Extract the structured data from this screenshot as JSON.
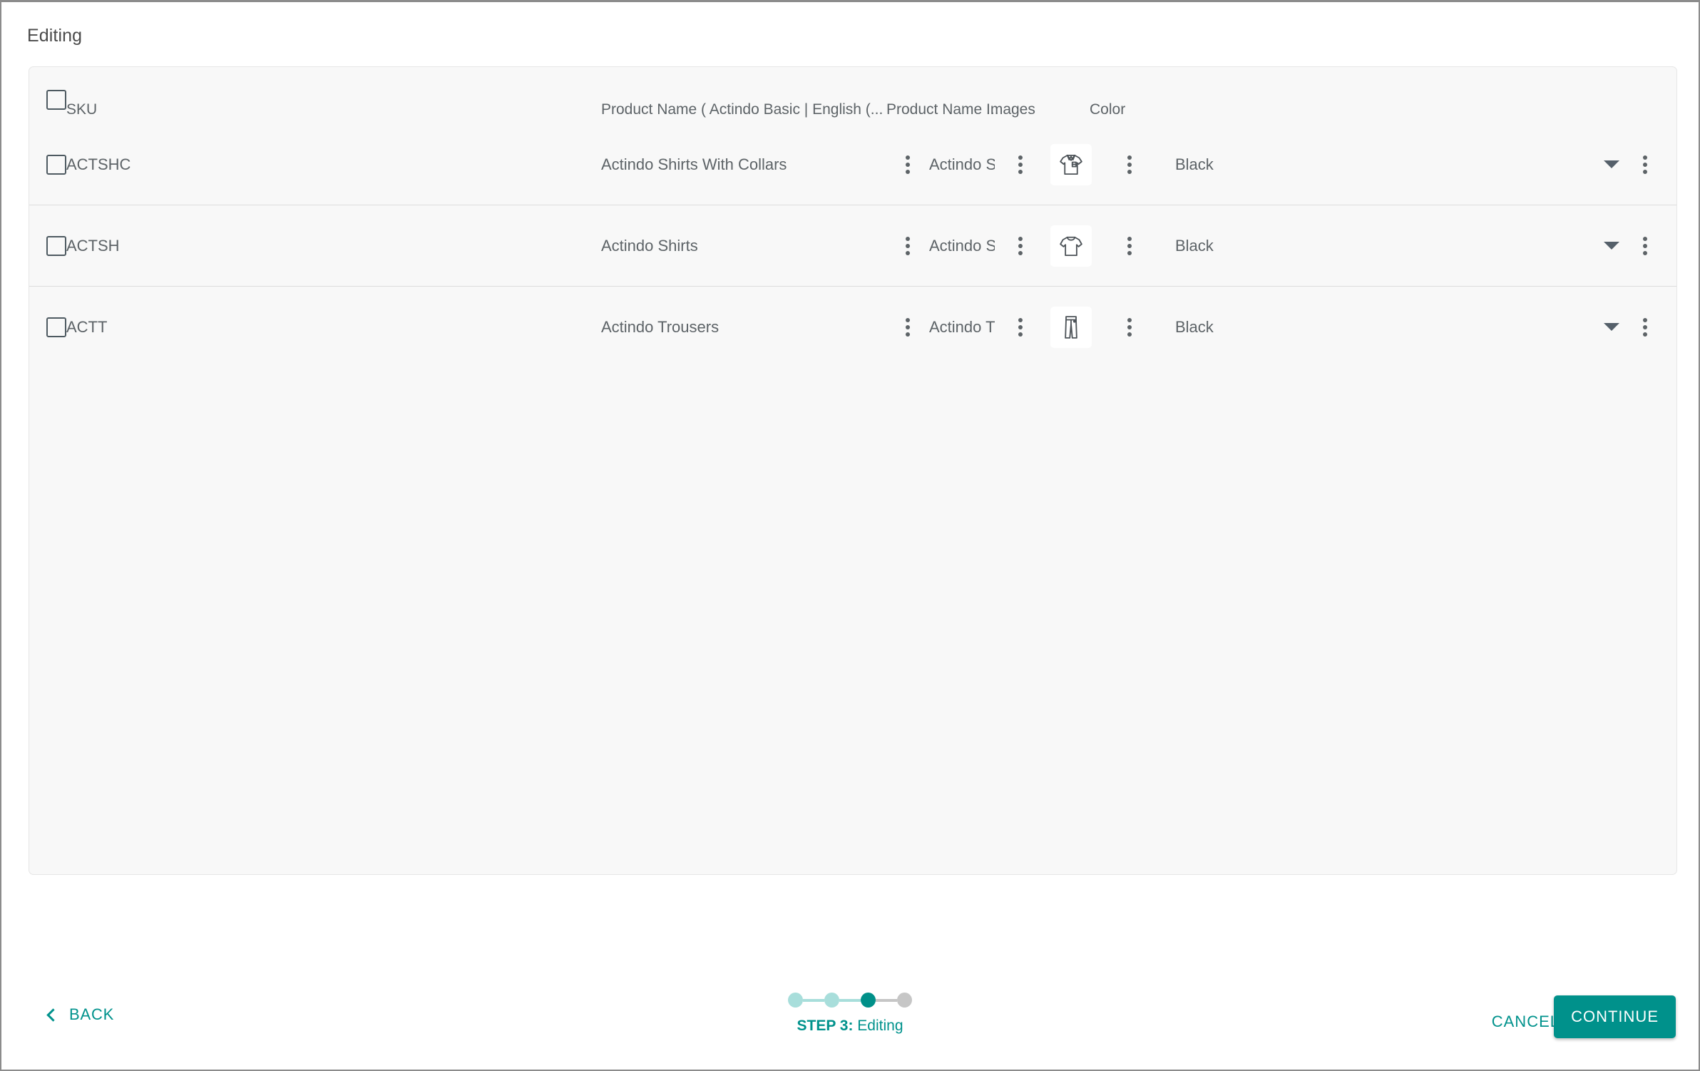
{
  "page": {
    "title": "Editing"
  },
  "table": {
    "columns": [
      {
        "key": "sku",
        "label": "SKU"
      },
      {
        "key": "name1",
        "label": "Product Name ( Actindo Basic | English (..."
      },
      {
        "key": "name2",
        "label": "Product Name ..."
      },
      {
        "key": "images",
        "label": "Images"
      },
      {
        "key": "color",
        "label": "Color"
      }
    ],
    "select_all_checked": false,
    "rows": [
      {
        "checked": false,
        "sku": "ACTSHC",
        "name1": "Actindo Shirts With Collars",
        "name2": "Actindo S",
        "image_icon": "polo-shirt-icon",
        "color": "Black"
      },
      {
        "checked": false,
        "sku": "ACTSH",
        "name1": "Actindo Shirts",
        "name2": "Actindo S",
        "image_icon": "t-shirt-icon",
        "color": "Black"
      },
      {
        "checked": false,
        "sku": "ACTT",
        "name1": "Actindo Trousers",
        "name2": "Actindo T",
        "image_icon": "trousers-icon",
        "color": "Black"
      }
    ]
  },
  "footer": {
    "back_label": "BACK",
    "cancel_label": "CANCEL",
    "continue_label": "CONTINUE",
    "stepper": {
      "steps": [
        "done",
        "done",
        "active",
        "todo"
      ],
      "segments": [
        "done",
        "done",
        "todo"
      ],
      "current_step_prefix": "STEP 3:",
      "current_step_name": " Editing"
    }
  },
  "colors": {
    "accent": "#00928c",
    "accent_light": "#a8dedb",
    "inactive": "#c6c6c6",
    "text": "#5d6367",
    "card_bg": "#f8f8f8"
  }
}
